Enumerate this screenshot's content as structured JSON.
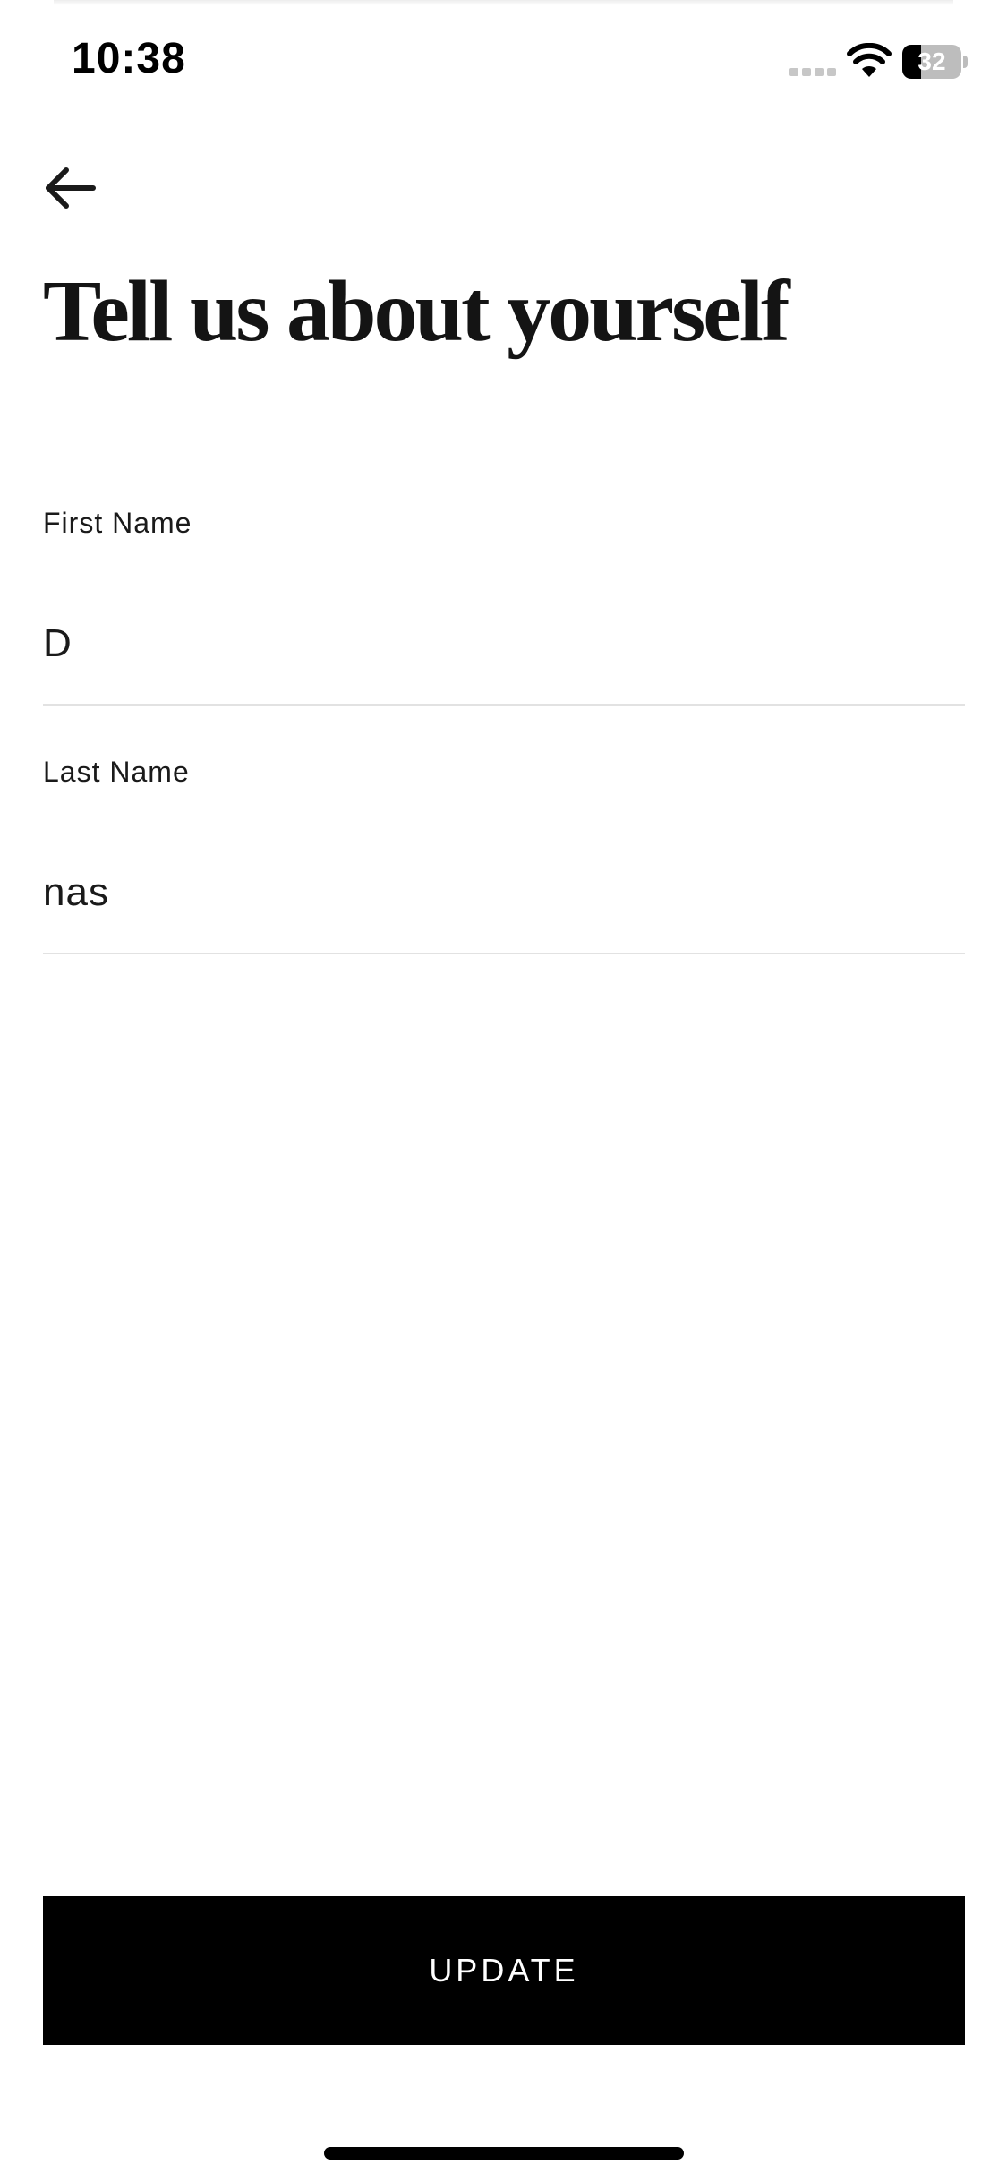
{
  "status_bar": {
    "time": "10:38",
    "battery_level": "32",
    "battery_fraction": 0.32
  },
  "icons": {
    "back": "arrow-left-icon",
    "signal": "cellular-signal-icon",
    "wifi": "wifi-icon",
    "battery": "battery-icon"
  },
  "page": {
    "title": "Tell us about yourself"
  },
  "form": {
    "first_name": {
      "label": "First Name",
      "value": "D"
    },
    "last_name": {
      "label": "Last Name",
      "value": "nas"
    }
  },
  "actions": {
    "update_label": "UPDATE"
  },
  "colors": {
    "button_background": "#000000",
    "button_text": "#ffffff",
    "divider": "#e2e2e2",
    "text": "#1a1a1a"
  }
}
